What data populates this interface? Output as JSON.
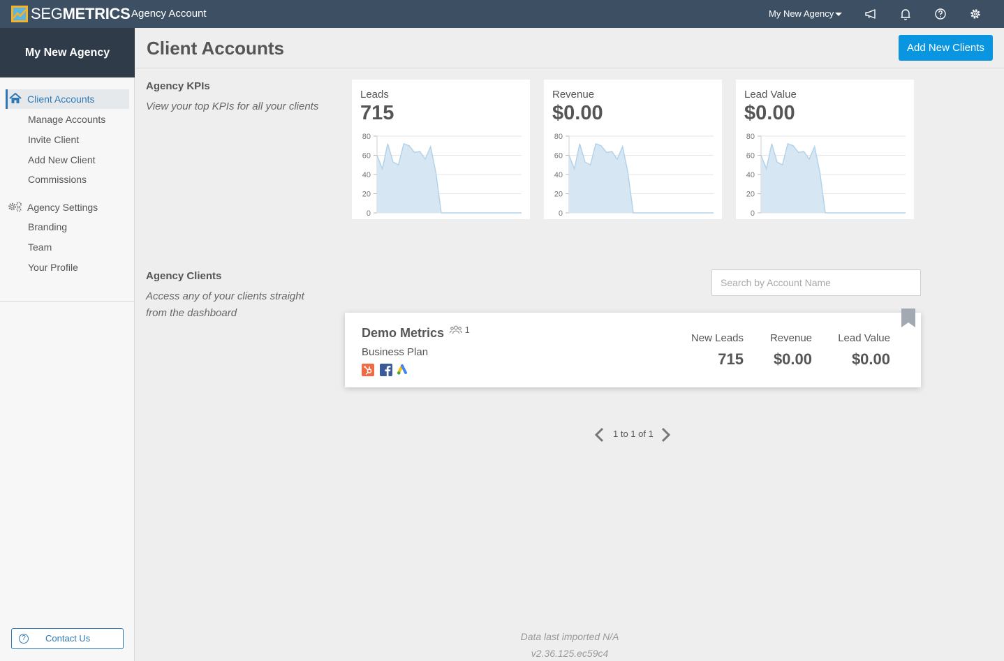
{
  "topbar": {
    "brand_light": "SEG",
    "brand_bold": "METRICS",
    "subtitle": "Agency Account",
    "agency_menu": "My New Agency",
    "icons": [
      "megaphone-icon",
      "bell-icon",
      "help-icon",
      "gear-icon"
    ]
  },
  "sidebar": {
    "agency_name": "My New Agency",
    "group1": {
      "label": "Client Accounts",
      "icon": "home-icon",
      "items": [
        "Manage Accounts",
        "Invite Client",
        "Add New Client",
        "Commissions"
      ]
    },
    "group2": {
      "label": "Agency Settings",
      "icon": "gears-icon",
      "items": [
        "Branding",
        "Team",
        "Your Profile"
      ]
    },
    "contact": "Contact Us"
  },
  "main": {
    "title": "Client Accounts",
    "add_button": "Add New Clients",
    "kpis_section": {
      "title": "Agency KPIs",
      "desc": "View your top KPIs for all your clients"
    },
    "clients_section": {
      "title": "Agency Clients",
      "desc1": "Access any of your clients straight",
      "desc2": "from the dashboard"
    },
    "search_placeholder": "Search by Account Name",
    "pager": "1 to 1 of 1",
    "footer": {
      "imported": "Data last imported N/A",
      "version": "v2.36.125.ec59c4"
    }
  },
  "kpi_cards": [
    {
      "label": "Leads",
      "value": "715"
    },
    {
      "label": "Revenue",
      "value": "$0.00"
    },
    {
      "label": "Lead Value",
      "value": "$0.00"
    }
  ],
  "client": {
    "name": "Demo Metrics",
    "users": "1",
    "plan": "Business Plan",
    "integrations": [
      "hubspot-icon",
      "facebook-icon",
      "google-ads-icon"
    ],
    "stats": [
      {
        "label": "New Leads",
        "value": "715"
      },
      {
        "label": "Revenue",
        "value": "$0.00"
      },
      {
        "label": "Lead Value",
        "value": "$0.00"
      }
    ]
  },
  "chart_data": {
    "type": "area",
    "ylim": [
      0,
      80
    ],
    "yticks": [
      "80",
      "60",
      "40",
      "20",
      "0"
    ],
    "values": [
      60,
      46,
      72,
      53,
      50,
      72,
      70,
      63,
      64,
      56,
      69,
      42,
      0,
      0,
      0,
      0,
      0,
      0,
      0,
      0,
      0,
      0,
      0,
      0,
      0,
      0,
      0,
      0
    ],
    "colors": {
      "fill": "#d6e7f3",
      "line": "#b3d3ea"
    }
  }
}
